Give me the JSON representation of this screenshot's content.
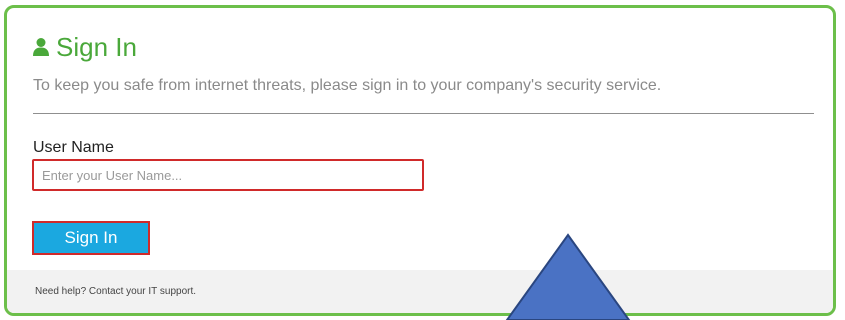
{
  "signin_card": {
    "title": "Sign In",
    "subtitle": "To keep you safe from internet threats, please sign in to your company's security service.",
    "username_label": "User Name",
    "username_value": "",
    "username_placeholder": "Enter your User Name...",
    "signin_button_label": "Sign In",
    "help_text": "Need help? Contact your IT support."
  },
  "icons": {
    "title_icon": "user-icon",
    "overlay_arrow": "up-arrow-icon"
  },
  "colors": {
    "card_border": "#6cbf4a",
    "title": "#4aa83a",
    "button": "#1ba8e0",
    "highlight": "#d02a2a",
    "arrow_fill": "#4a72c4",
    "arrow_stroke": "#2a4680"
  }
}
